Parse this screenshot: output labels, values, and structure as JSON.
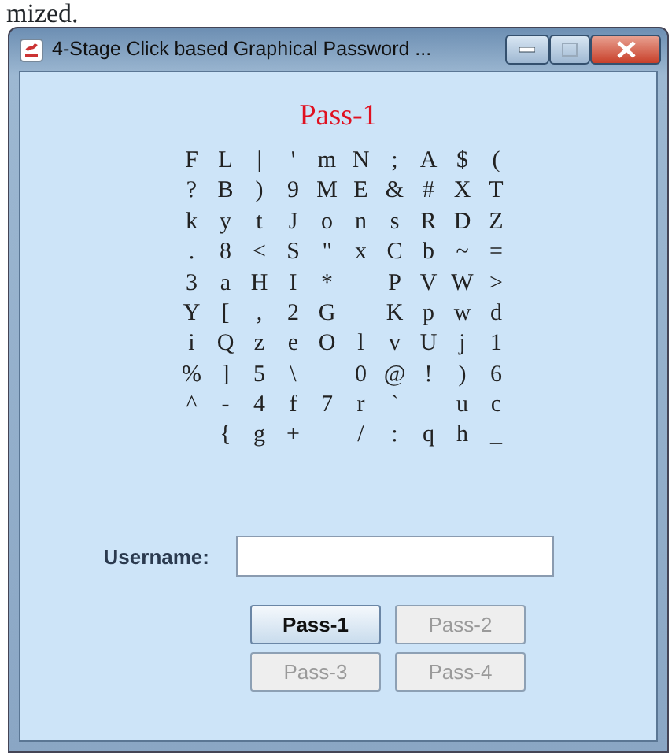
{
  "above_text": "mized.",
  "window": {
    "title": "4-Stage Click based Graphical Password ..."
  },
  "heading": "Pass-1",
  "grid_rows": [
    [
      "F",
      "L",
      "|",
      "'",
      "m",
      "N",
      ";",
      "A",
      "$",
      "("
    ],
    [
      "?",
      "B",
      ")",
      "9",
      "M",
      "E",
      "&",
      "#",
      "X",
      "T"
    ],
    [
      "k",
      "y",
      "t",
      "J",
      "o",
      "n",
      "s",
      "R",
      "D",
      "Z"
    ],
    [
      ".",
      "8",
      "<",
      "S",
      "\"",
      "x",
      "C",
      "b",
      "~",
      "="
    ],
    [
      "3",
      "a",
      "H",
      "I",
      "*",
      null,
      "P",
      "V",
      "W",
      ">"
    ],
    [
      "Y",
      "[",
      ",",
      "2",
      "G",
      null,
      "K",
      "p",
      "w",
      "d"
    ],
    [
      "i",
      "Q",
      "z",
      "e",
      "O",
      "l",
      "v",
      "U",
      "j",
      "1"
    ],
    [
      "%",
      "]",
      "5",
      "\\",
      null,
      "0",
      "@",
      "!",
      ")",
      "6"
    ],
    [
      "^",
      "-",
      "4",
      "f",
      "7",
      "r",
      "`",
      null,
      "u",
      "c"
    ],
    [
      null,
      "{",
      "g",
      "+",
      null,
      "/",
      ":",
      "q",
      "h",
      "_"
    ]
  ],
  "username": {
    "label": "Username:"
  },
  "buttons": [
    {
      "label": "Pass-1",
      "disabled": false
    },
    {
      "label": "Pass-2",
      "disabled": true
    },
    {
      "label": "Pass-3",
      "disabled": true
    },
    {
      "label": "Pass-4",
      "disabled": true
    }
  ]
}
